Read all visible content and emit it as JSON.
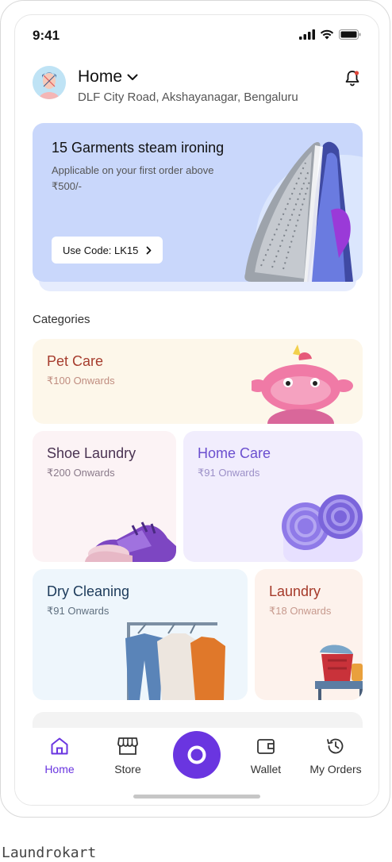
{
  "status": {
    "time": "9:41"
  },
  "header": {
    "location_title": "Home",
    "address": "DLF City Road, Akshayanagar, Bengaluru"
  },
  "promo": {
    "title": "15 Garments steam ironing",
    "description": "Applicable on your first order above ₹500/-",
    "code_label": "Use Code: LK15"
  },
  "categories": {
    "label": "Categories",
    "items": [
      {
        "title": "Pet Care",
        "subtitle": "₹100 Onwards",
        "title_color": "#a63d2e",
        "sub_color": "#c08d80",
        "bg": "#fdf7ea"
      },
      {
        "title": "Shoe Laundry",
        "subtitle": "₹200 Onwards",
        "title_color": "#4a3352",
        "sub_color": "#8a7a8a",
        "bg": "#fcf3f5"
      },
      {
        "title": "Home Care",
        "subtitle": "₹91 Onwards",
        "title_color": "#6b4fcf",
        "sub_color": "#9c90c8",
        "bg": "#f1edfd"
      },
      {
        "title": "Dry Cleaning",
        "subtitle": "₹91 Onwards",
        "title_color": "#1c3a5a",
        "sub_color": "#607080",
        "bg": "#eef6fc"
      },
      {
        "title": "Laundry",
        "subtitle": "₹18 Onwards",
        "title_color": "#a53a2a",
        "sub_color": "#c79a8e",
        "bg": "#fdf2ec"
      }
    ]
  },
  "nav": {
    "items": [
      {
        "label": "Home",
        "icon": "home-icon",
        "active": true
      },
      {
        "label": "Store",
        "icon": "store-icon",
        "active": false
      },
      {
        "label": "Wallet",
        "icon": "wallet-icon",
        "active": false
      },
      {
        "label": "My Orders",
        "icon": "history-icon",
        "active": false
      }
    ],
    "active_color": "#6a35e0",
    "fab_color": "#6a35e0"
  },
  "caption": "Laundrokart"
}
